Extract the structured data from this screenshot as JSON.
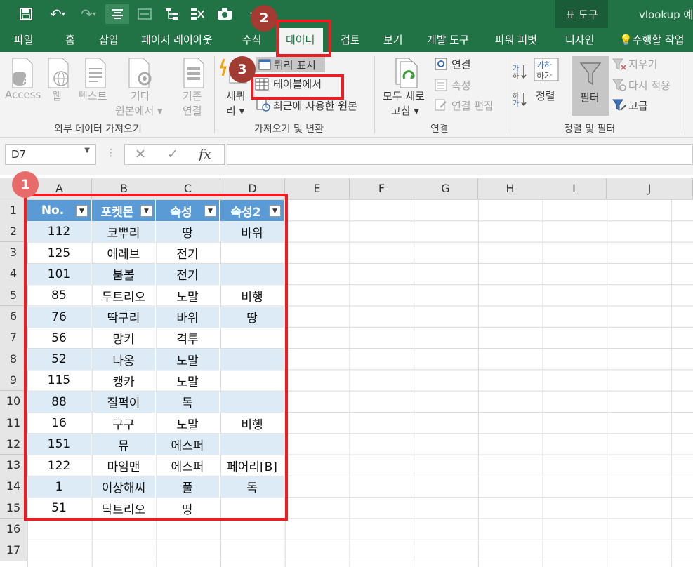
{
  "qat": {
    "undo_arrow": "▾"
  },
  "title": {
    "tool_tab": "표 도구",
    "window": "vlookup 예"
  },
  "tabs": {
    "file": "파일",
    "home": "홈",
    "insert": "삽입",
    "layout": "페이지 레이아웃",
    "formulas": "수식",
    "data": "데이터",
    "review": "검토",
    "view": "보기",
    "developer": "개발 도구",
    "powerpivot": "파워 피벗",
    "design": "디자인",
    "tellme": "수행할 작업"
  },
  "ribbon": {
    "external": {
      "access": "Access",
      "web": "웹",
      "text": "텍스트",
      "other_1": "기타",
      "other_2": "원본에서",
      "existing_1": "기존",
      "existing_2": "연결",
      "group": "외부 데이터 가져오기"
    },
    "transform": {
      "newquery_1": "새쿼",
      "newquery_2": "리",
      "show_queries": "쿼리 표시",
      "from_table": "테이블에서",
      "recent": "최근에 사용한 원본",
      "group": "가져오기 및 변환"
    },
    "connections": {
      "refresh_1": "모두 새로",
      "refresh_2": "고침",
      "connections": "연결",
      "properties": "속성",
      "edit_links": "연결 편집",
      "group": "연결"
    },
    "sort": {
      "sort": "정렬",
      "filter": "필터",
      "clear": "지우기",
      "reapply": "다시 적용",
      "advanced": "고급",
      "group": "정렬 및 필터"
    }
  },
  "formula_bar": {
    "name_box": "D7",
    "fx": "fx",
    "cancel": "✕",
    "enter": "✓",
    "dots": "⋮"
  },
  "columns": [
    "A",
    "B",
    "C",
    "D",
    "E",
    "F",
    "G",
    "H",
    "I",
    "J"
  ],
  "rows": [
    "1",
    "2",
    "3",
    "4",
    "5",
    "6",
    "7",
    "8",
    "9",
    "10",
    "11",
    "12",
    "13",
    "14",
    "15",
    "16",
    "17"
  ],
  "table": {
    "headers": [
      "No.",
      "포켓몬",
      "속성",
      "속성2"
    ],
    "rows": [
      [
        "112",
        "코뿌리",
        "땅",
        "바위"
      ],
      [
        "125",
        "에레브",
        "전기",
        ""
      ],
      [
        "101",
        "붐볼",
        "전기",
        ""
      ],
      [
        "85",
        "두트리오",
        "노말",
        "비행"
      ],
      [
        "76",
        "딱구리",
        "바위",
        "땅"
      ],
      [
        "56",
        "망키",
        "격투",
        ""
      ],
      [
        "52",
        "나옹",
        "노말",
        ""
      ],
      [
        "115",
        "캥카",
        "노말",
        ""
      ],
      [
        "88",
        "질퍽이",
        "독",
        ""
      ],
      [
        "16",
        "구구",
        "노말",
        "비행"
      ],
      [
        "151",
        "뮤",
        "에스퍼",
        ""
      ],
      [
        "122",
        "마임맨",
        "에스퍼",
        "페어리[B]"
      ],
      [
        "1",
        "이상해씨",
        "풀",
        "독"
      ],
      [
        "51",
        "닥트리오",
        "땅",
        ""
      ]
    ]
  },
  "callouts": {
    "step1": "1",
    "step2": "2",
    "step3": "3"
  },
  "colors": {
    "excel_green": "#217346",
    "table_header": "#5b9bd5",
    "table_band": "#ddebf7",
    "callout_red": "#ee1d24"
  }
}
